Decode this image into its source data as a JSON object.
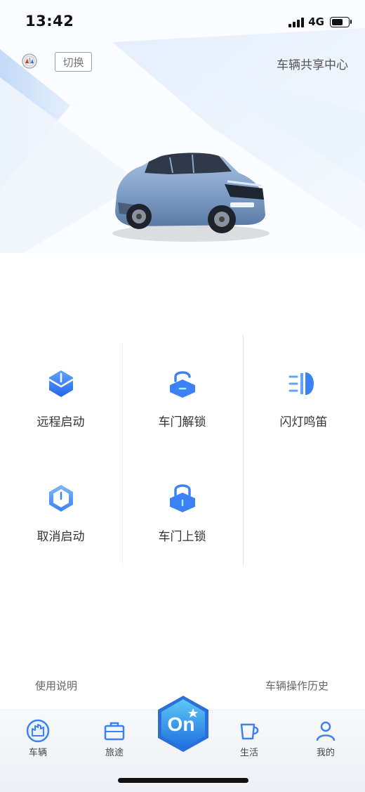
{
  "status_bar": {
    "time": "13:42",
    "network": "4G",
    "battery_level": 0.75
  },
  "header": {
    "switch_label": "切换",
    "share_center_label": "车辆共享中心"
  },
  "controls": {
    "remote_start": "远程启动",
    "door_unlock": "车门解锁",
    "flash_horn": "闪灯鸣笛",
    "cancel_start": "取消启动",
    "door_lock": "车门上锁"
  },
  "footer": {
    "instructions": "使用说明",
    "history": "车辆操作历史"
  },
  "tabbar": {
    "vehicle": "车辆",
    "trip": "旅途",
    "on": "On",
    "life": "生活",
    "mine": "我的"
  },
  "colors": {
    "accent": "#3b82f6",
    "accent_light": "#60a5fa",
    "on_cyan": "#22d3ee"
  }
}
